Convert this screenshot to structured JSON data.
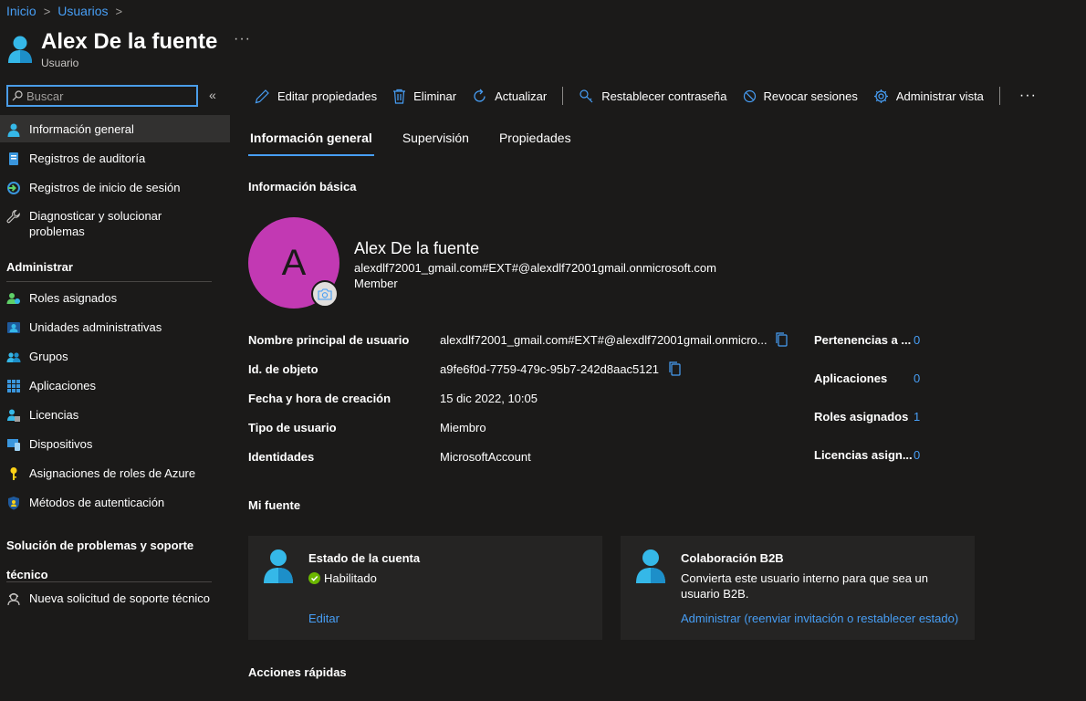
{
  "breadcrumb": {
    "home": "Inicio",
    "users": "Usuarios"
  },
  "header": {
    "title": "Alex De la fuente",
    "subtitle": "Usuario",
    "more": "···"
  },
  "search": {
    "placeholder": "Buscar",
    "collapse": "«"
  },
  "sidebar": {
    "items": [
      {
        "label": "Información general",
        "icon": "user-icon"
      },
      {
        "label": "Registros de auditoría",
        "icon": "audit-log-icon"
      },
      {
        "label": "Registros de inicio de sesión",
        "icon": "sign-in-log-icon"
      },
      {
        "label": "Diagnosticar y solucionar problemas",
        "icon": "wrench-icon"
      }
    ],
    "admin_section": "Administrar",
    "admin_items": [
      {
        "label": "Roles asignados",
        "icon": "assigned-roles-icon"
      },
      {
        "label": "Unidades administrativas",
        "icon": "admin-units-icon"
      },
      {
        "label": "Grupos",
        "icon": "groups-icon"
      },
      {
        "label": "Aplicaciones",
        "icon": "apps-grid-icon"
      },
      {
        "label": "Licencias",
        "icon": "licenses-icon"
      },
      {
        "label": "Dispositivos",
        "icon": "devices-icon"
      },
      {
        "label": "Asignaciones de roles de Azure",
        "icon": "key-icon"
      },
      {
        "label": "Métodos de autenticación",
        "icon": "shield-icon"
      }
    ],
    "support_section": "Solución de problemas y soporte técnico",
    "support_items": [
      {
        "label": "Nueva solicitud de soporte técnico",
        "icon": "support-person-icon"
      }
    ]
  },
  "toolbar": {
    "edit": "Editar propiedades",
    "delete": "Eliminar",
    "refresh": "Actualizar",
    "reset_password": "Restablecer contraseña",
    "revoke": "Revocar sesiones",
    "manage_view": "Administrar vista",
    "more": "···"
  },
  "tabs": [
    "Información general",
    "Supervisión",
    "Propiedades"
  ],
  "basic_info": {
    "title": "Información básica",
    "avatar_letter": "A",
    "name": "Alex De la fuente",
    "email": "alexdlf72001_gmail.com#EXT#@alexdlf72001gmail.onmicrosoft.com",
    "member": "Member"
  },
  "properties": [
    {
      "label": "Nombre principal de usuario",
      "value": "alexdlf72001_gmail.com#EXT#@alexdlf72001gmail.onmicro..."
    },
    {
      "label": "Id. de objeto",
      "value": "a9fe6f0d-7759-479c-95b7-242d8aac5121"
    },
    {
      "label": "Fecha y hora de creación",
      "value": "15 dic 2022, 10:05"
    },
    {
      "label": "Tipo de usuario",
      "value": "Miembro"
    },
    {
      "label": "Identidades",
      "value": "MicrosoftAccount"
    }
  ],
  "stats": [
    {
      "label": "Pertenencias a ...",
      "value": "0"
    },
    {
      "label": "Aplicaciones",
      "value": "0"
    },
    {
      "label": "Roles asignados",
      "value": "1"
    },
    {
      "label": "Licencias asign...",
      "value": "0"
    }
  ],
  "my_feed": {
    "title": "Mi fuente",
    "account_card": {
      "title": "Estado de la cuenta",
      "status": "Habilitado",
      "link": "Editar"
    },
    "b2b_card": {
      "title": "Colaboración B2B",
      "text": "Convierta este usuario interno para que sea un usuario B2B.",
      "link": "Administrar (reenviar invitación o restablecer estado)"
    }
  },
  "quick_actions": {
    "title": "Acciones rápidas"
  },
  "colors": {
    "accent": "#479ef5",
    "avatar": "#c239b3",
    "background": "#1b1a19",
    "success": "#6bb700"
  }
}
